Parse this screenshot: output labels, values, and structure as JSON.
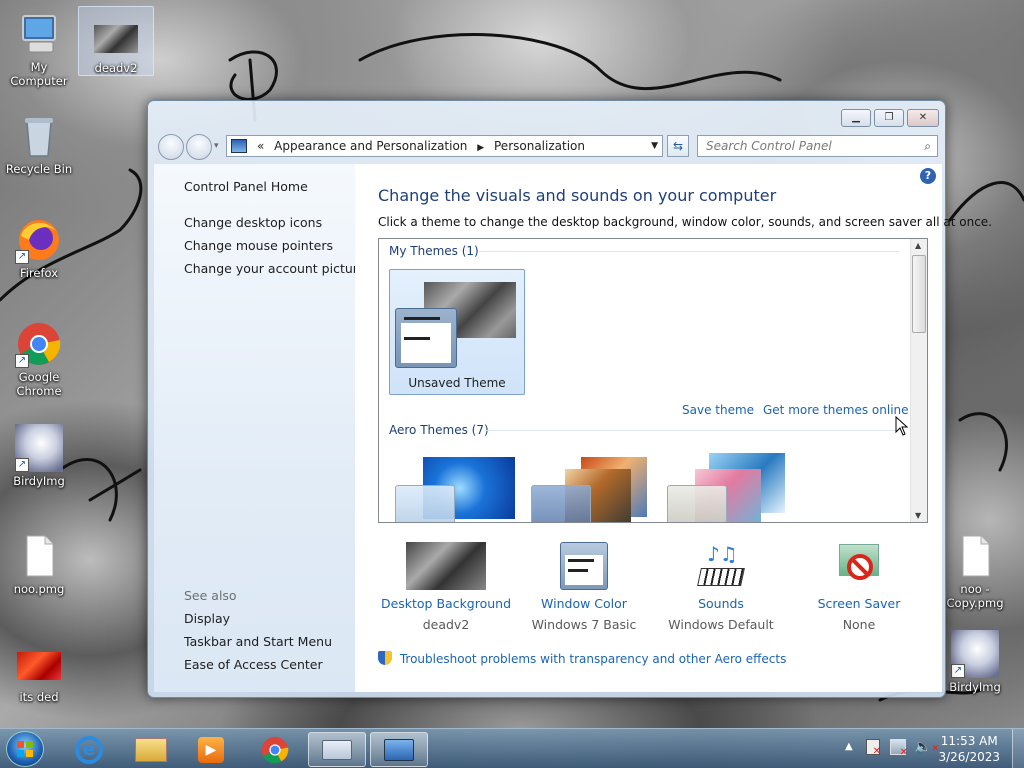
{
  "desktop": {
    "icons": [
      {
        "label": "My Computer"
      },
      {
        "label": "deadv2"
      },
      {
        "label": "Recycle Bin"
      },
      {
        "label": "Firefox"
      },
      {
        "label": "Google Chrome"
      },
      {
        "label": "BirdyImg"
      },
      {
        "label": "noo.pmg"
      },
      {
        "label": "its ded"
      },
      {
        "label": "noo - Copy.pmg"
      },
      {
        "label": "BirdyImg"
      }
    ]
  },
  "window": {
    "address": {
      "root_glyph": "«",
      "crumbs": [
        "Appearance and Personalization",
        "Personalization"
      ]
    },
    "search": {
      "placeholder": "Search Control Panel"
    },
    "left_pane": {
      "home": "Control Panel Home",
      "links": [
        "Change desktop icons",
        "Change mouse pointers",
        "Change your account picture"
      ],
      "see_also": "See also",
      "see_also_links": [
        "Display",
        "Taskbar and Start Menu",
        "Ease of Access Center"
      ]
    },
    "main": {
      "title": "Change the visuals and sounds on your computer",
      "subtitle": "Click a theme to change the desktop background, window color, sounds, and screen saver all at once.",
      "my_themes_header": "My Themes (1)",
      "unsaved_theme": "Unsaved Theme",
      "save_theme": "Save theme",
      "get_more": "Get more themes online",
      "aero_header": "Aero Themes (7)",
      "bottom": [
        {
          "label": "Desktop Background",
          "value": "deadv2"
        },
        {
          "label": "Window Color",
          "value": "Windows 7 Basic"
        },
        {
          "label": "Sounds",
          "value": "Windows Default"
        },
        {
          "label": "Screen Saver",
          "value": "None"
        }
      ],
      "troubleshoot": "Troubleshoot problems with transparency and other Aero effects"
    }
  },
  "taskbar": {
    "time": "11:53 AM",
    "date": "3/26/2023"
  }
}
